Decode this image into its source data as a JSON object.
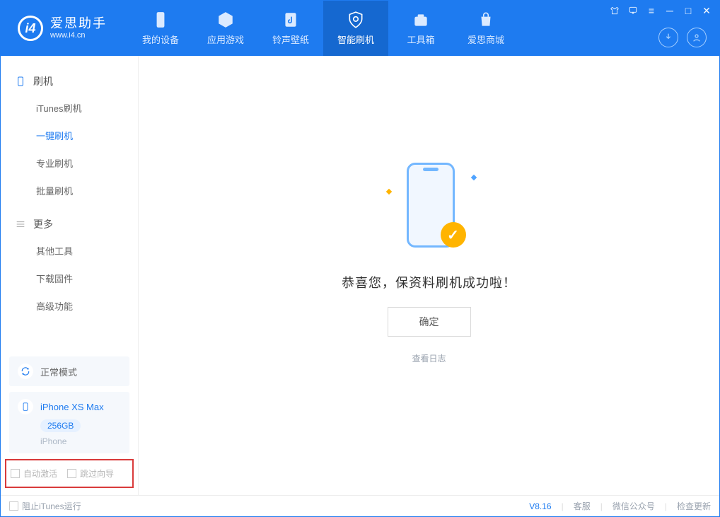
{
  "brand": {
    "title": "爱思助手",
    "subtitle": "www.i4.cn"
  },
  "nav": {
    "device": "我的设备",
    "apps": "应用游戏",
    "ringtone": "铃声壁纸",
    "flash": "智能刷机",
    "toolbox": "工具箱",
    "store": "爱思商城"
  },
  "sidebar": {
    "cat_flash": "刷机",
    "items_flash": [
      "iTunes刷机",
      "一键刷机",
      "专业刷机",
      "批量刷机"
    ],
    "cat_more": "更多",
    "items_more": [
      "其他工具",
      "下载固件",
      "高级功能"
    ]
  },
  "device": {
    "mode": "正常模式",
    "name": "iPhone XS Max",
    "storage": "256GB",
    "model": "iPhone"
  },
  "options": {
    "auto_activate": "自动激活",
    "skip_guide": "跳过向导"
  },
  "main": {
    "success": "恭喜您，保资料刷机成功啦！",
    "confirm": "确定",
    "view_log": "查看日志"
  },
  "footer": {
    "block_itunes": "阻止iTunes运行",
    "version": "V8.16",
    "service": "客服",
    "wechat": "微信公众号",
    "update": "检查更新"
  }
}
